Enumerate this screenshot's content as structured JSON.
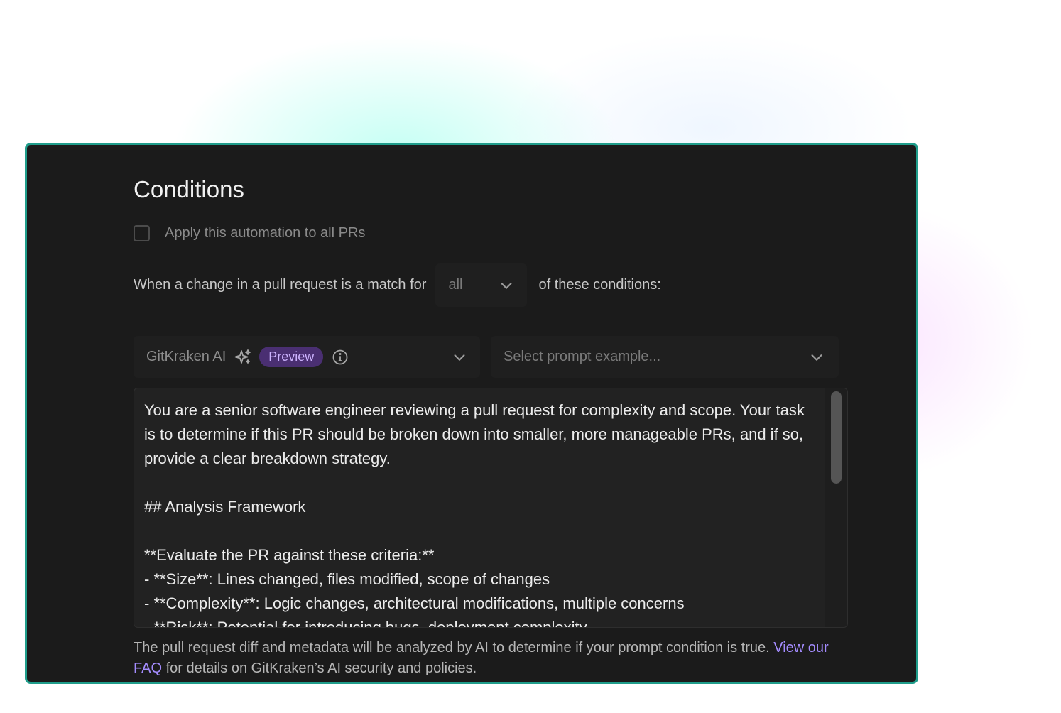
{
  "conditions": {
    "title": "Conditions",
    "apply_all": {
      "label": "Apply this automation to all PRs",
      "checked": false
    },
    "match": {
      "prefix": "When a change in a pull request is a match for",
      "selected": "all",
      "suffix": "of these conditions:"
    },
    "ai_source": {
      "label": "GitKraken AI",
      "badge": "Preview",
      "spark_icon": "sparkles-icon",
      "info_icon": "info-icon"
    },
    "prompt_example": {
      "placeholder": "Select prompt example..."
    },
    "prompt": {
      "text": "You are a senior software engineer reviewing a pull request for complexity and scope. Your task is to determine if this PR should be broken down into smaller, more manageable PRs, and if so, provide a clear breakdown strategy.\n\n## Analysis Framework\n\n**Evaluate the PR against these criteria:**\n- **Size**: Lines changed, files modified, scope of changes\n- **Complexity**: Logic changes, architectural modifications, multiple concerns\n- **Risk**: Potential for introducing bugs, deployment complexity"
    },
    "footnote": {
      "part1": "The pull request diff and metadata will be analyzed by AI to determine if your prompt condition is true. ",
      "link": "View our FAQ",
      "part2": " for details on GitKraken’s AI security and policies."
    }
  },
  "colors": {
    "border_accent": "#1f9d8b",
    "panel_bg": "#1b1b1b",
    "badge_bg": "#4a2f72",
    "badge_text": "#cdb3ff",
    "link": "#a48cff"
  }
}
